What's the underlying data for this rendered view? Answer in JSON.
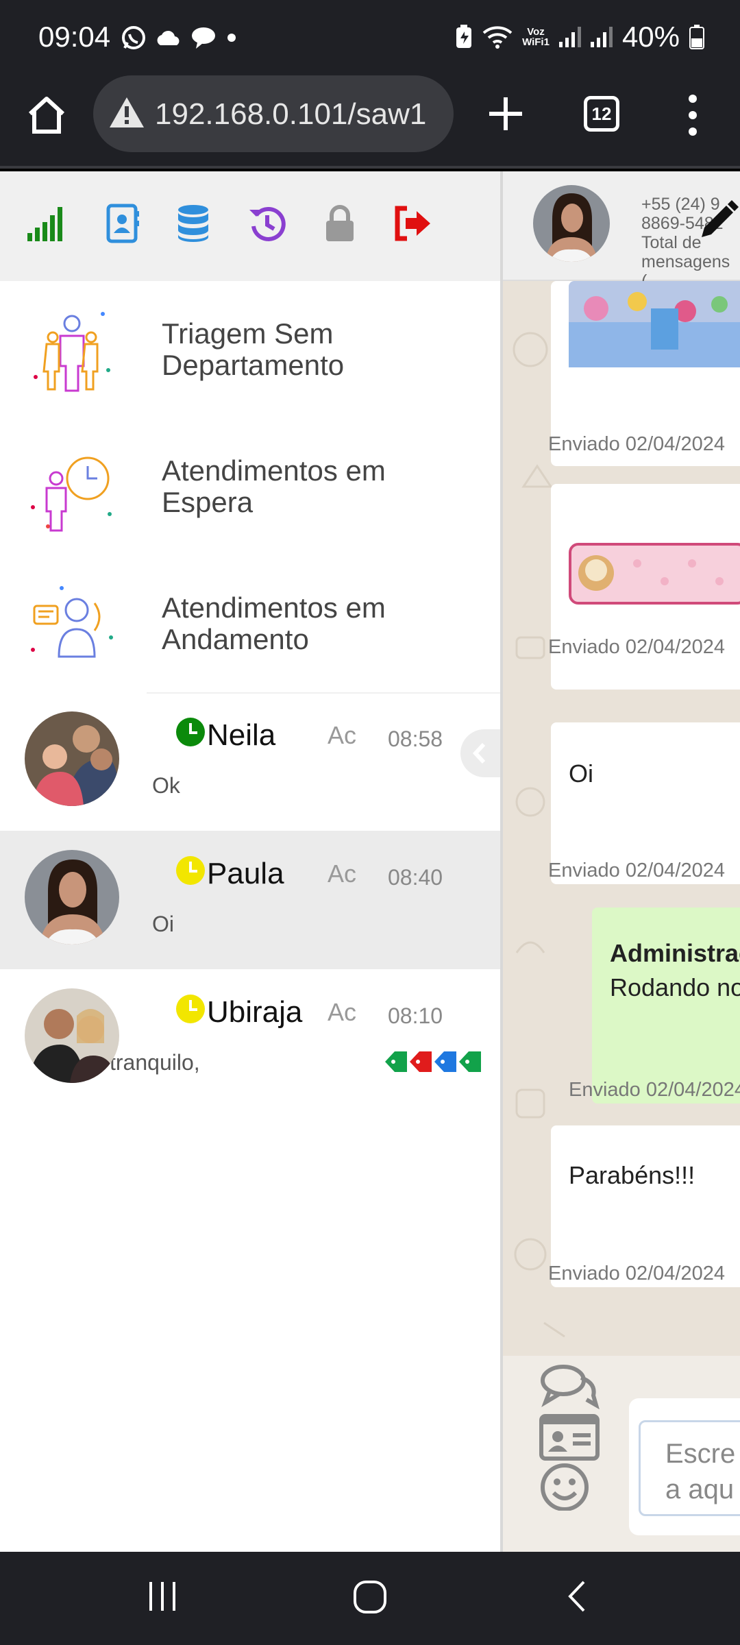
{
  "status_bar": {
    "time": "09:04",
    "network_label": "Voz\nWiFi1",
    "battery": "40%"
  },
  "browser": {
    "url": "192.168.0.101/saw1",
    "tab_count": "12"
  },
  "toolbar": {
    "icons": [
      "signal-icon",
      "contacts-icon",
      "database-icon",
      "history-icon",
      "lock-icon",
      "logout-icon"
    ],
    "colors": {
      "signal": "#1a8a1a",
      "contacts": "#2f8fdc",
      "database": "#2f8fdc",
      "history": "#8a3fd0",
      "lock": "#999999",
      "logout": "#e01010"
    }
  },
  "menu": [
    {
      "label": "Triagem Sem Departamento"
    },
    {
      "label": "Atendimentos em Espera"
    },
    {
      "label": "Atendimentos em Andamento"
    }
  ],
  "chats": [
    {
      "name": "Neila",
      "status": "Ac",
      "time": "08:58",
      "preview": "Ok",
      "clock_color": "#0b8a0b"
    },
    {
      "name": "Paula",
      "status": "Ac",
      "time": "08:40",
      "preview": "Oi",
      "clock_color": "#f2e600"
    },
    {
      "name": "Ubiraja",
      "status": "Ac",
      "time": "08:10",
      "preview": "tranquilo,",
      "clock_color": "#f2e600",
      "tag_colors": [
        "#12a24a",
        "#e01c1c",
        "#1f78e0",
        "#12a24a"
      ]
    }
  ],
  "conversation": {
    "contact_phone": "+55 (24) 9 8869-5482",
    "total_label": "Total de mensagens",
    "total_suffix": "(",
    "messages": [
      {
        "text": "",
        "meta": "Enviado 02/04/2024"
      },
      {
        "text": "",
        "meta": "Enviado 02/04/2024"
      },
      {
        "text": "Oi",
        "meta": "Enviado 02/04/2024"
      },
      {
        "author": "Administrac",
        "text": "Rodando no",
        "meta": "Enviado 02/04/2024"
      },
      {
        "text": "Parabéns!!!",
        "meta": "Enviado 02/04/2024"
      }
    ],
    "composer_placeholder": "Escre a aqu"
  }
}
